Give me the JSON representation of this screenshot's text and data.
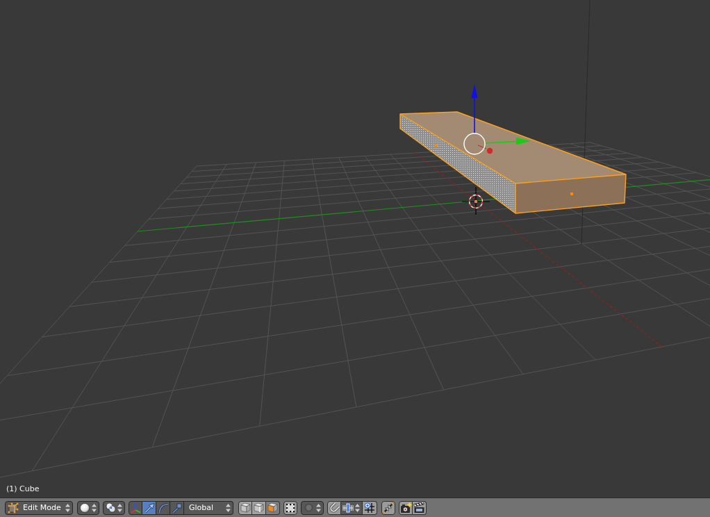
{
  "viewport": {
    "object_label": "(1) Cube"
  },
  "header": {
    "mode_menu": {
      "label": "Edit Mode"
    },
    "manipulator_buttons": [
      {
        "selected": false
      },
      {
        "selected": true
      },
      {
        "selected": false
      },
      {
        "selected": false
      }
    ],
    "orientation_menu": {
      "label": "Global"
    },
    "select_mode_buttons": [
      {
        "selected": false
      },
      {
        "selected": false
      },
      {
        "selected": true
      }
    ]
  }
}
